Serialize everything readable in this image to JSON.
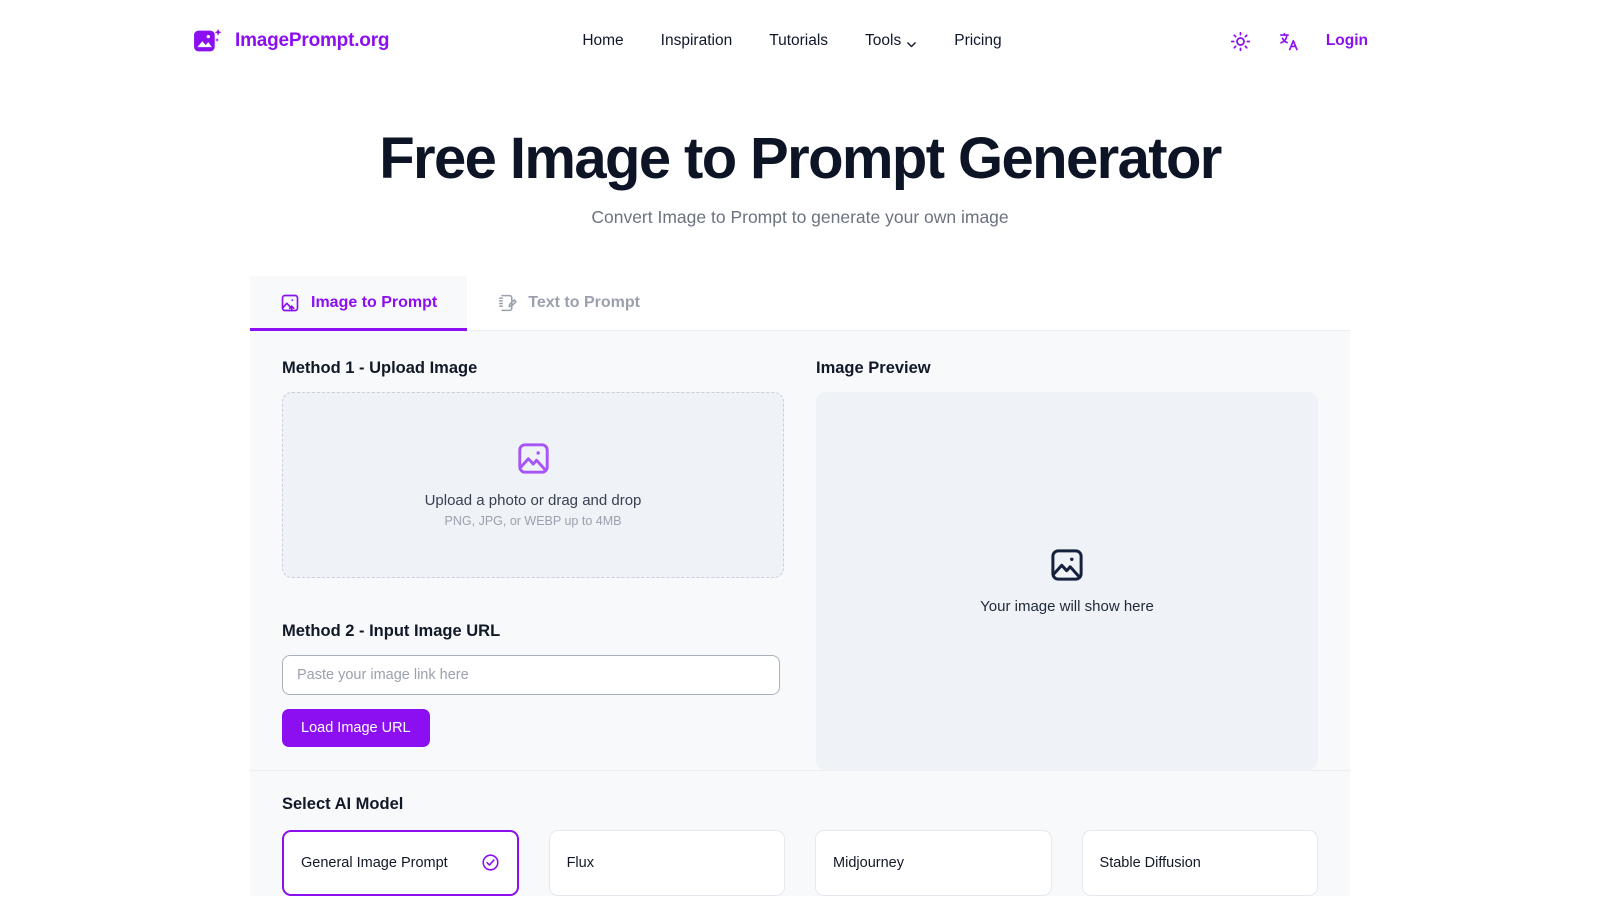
{
  "header": {
    "brand_name": "ImagePrompt.org",
    "brand_logo_icon": "image-sparkle-icon",
    "nav": [
      {
        "label": "Home",
        "has_chevron": false
      },
      {
        "label": "Inspiration",
        "has_chevron": false
      },
      {
        "label": "Tutorials",
        "has_chevron": false
      },
      {
        "label": "Tools",
        "has_chevron": true
      },
      {
        "label": "Pricing",
        "has_chevron": false
      }
    ],
    "theme_toggle_icon": "sun-icon",
    "language_icon": "translate-icon",
    "login_label": "Login",
    "accent_color": "#8b0ff0"
  },
  "hero": {
    "title": "Free Image to Prompt Generator",
    "subtitle": "Convert Image to Prompt to generate your own image"
  },
  "tabs": [
    {
      "label": "Image to Prompt",
      "icon": "image-upload-icon",
      "active": true
    },
    {
      "label": "Text to Prompt",
      "icon": "notebook-pencil-icon",
      "active": false
    }
  ],
  "upload": {
    "method1_title": "Method 1 - Upload Image",
    "dropzone_icon": "image-icon",
    "dropzone_main": "Upload a photo or drag and drop",
    "dropzone_sub": "PNG, JPG, or WEBP up to 4MB",
    "method2_title": "Method 2 - Input Image URL",
    "url_placeholder": "Paste your image link here",
    "url_value": "",
    "load_button": "Load Image URL"
  },
  "preview": {
    "title": "Image Preview",
    "placeholder_icon": "image-icon",
    "placeholder_text": "Your image will show here"
  },
  "models": {
    "title": "Select AI Model",
    "items": [
      {
        "label": "General Image Prompt",
        "selected": true,
        "check_icon": "check-circle-icon"
      },
      {
        "label": "Flux",
        "selected": false
      },
      {
        "label": "Midjourney",
        "selected": false
      },
      {
        "label": "Stable Diffusion",
        "selected": false
      }
    ]
  }
}
